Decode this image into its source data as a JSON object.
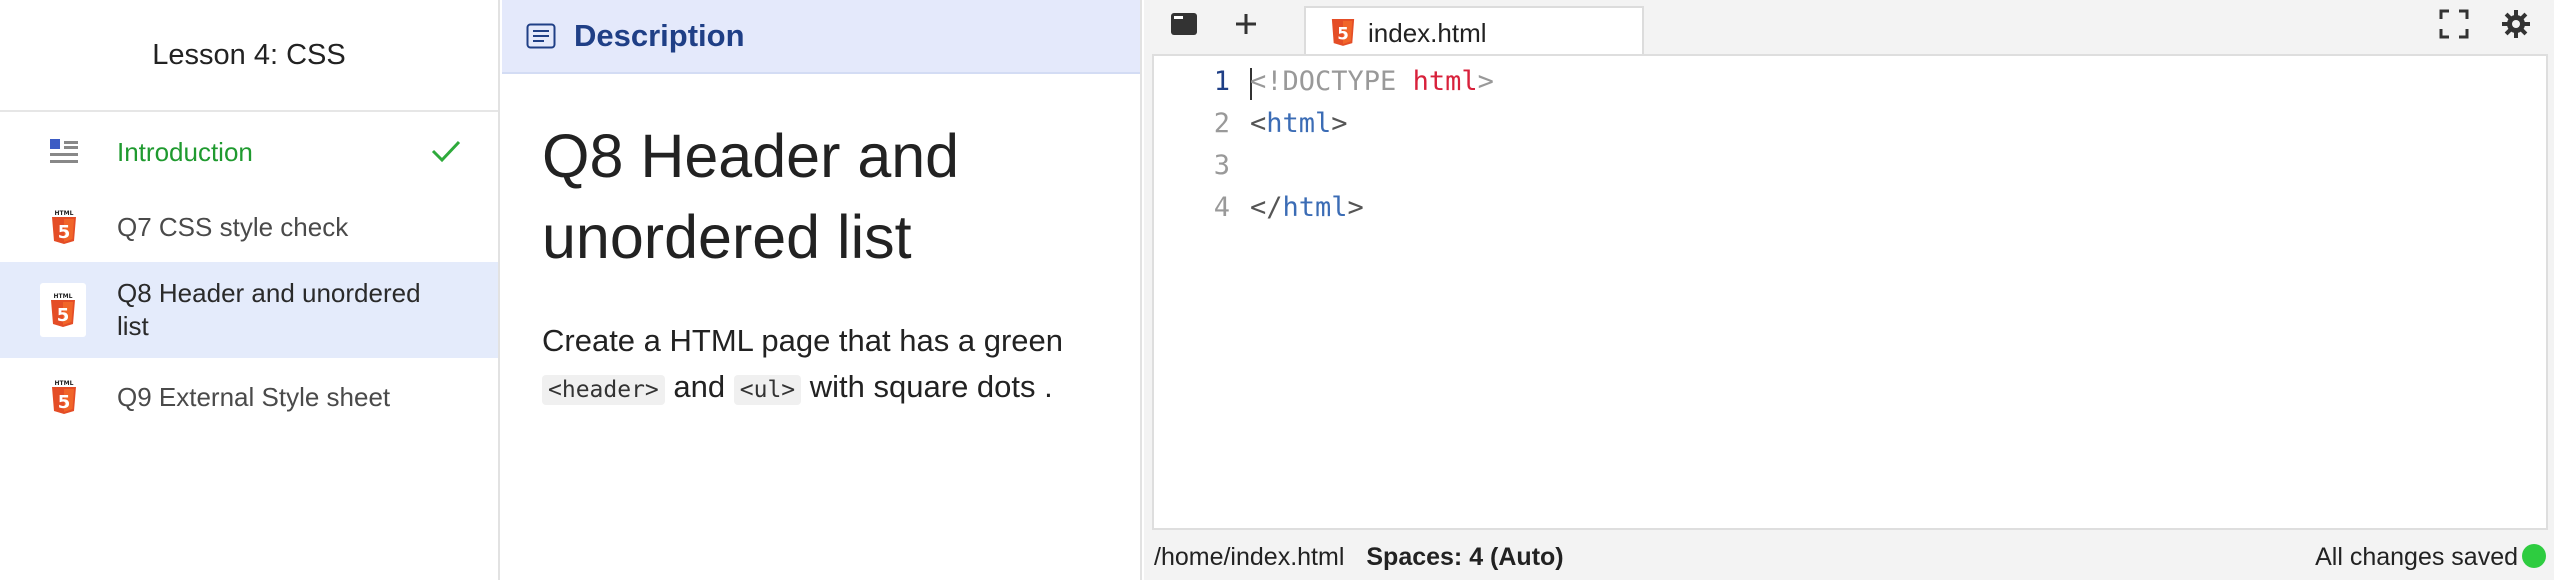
{
  "sidebar": {
    "lesson_title": "Lesson 4: CSS",
    "items": [
      {
        "label": "Introduction",
        "icon": "list-doc-icon",
        "completed": true
      },
      {
        "label": "Q7 CSS style check",
        "icon": "html5-icon"
      },
      {
        "label": "Q8 Header and unordered list",
        "icon": "html5-icon",
        "selected": true
      },
      {
        "label": "Q9 External Style sheet",
        "icon": "html5-icon"
      }
    ]
  },
  "description": {
    "header": "Description",
    "title": "Q8 Header and unordered list",
    "body_1": "Create a HTML page that has a green",
    "code_1": "<header>",
    "body_2": "and",
    "code_2": "<ul>",
    "body_3": "with square dots ."
  },
  "editor": {
    "tab_label": "index.html",
    "lines": [
      {
        "num": "1",
        "text": "<!DOCTYPE html>"
      },
      {
        "num": "2",
        "text": "<html>"
      },
      {
        "num": "3",
        "text": ""
      },
      {
        "num": "4",
        "text": "</html>"
      }
    ],
    "status": {
      "path": "/home/index.html",
      "spaces": "Spaces: 4 (Auto)",
      "saved": "All changes saved"
    }
  },
  "colors": {
    "accent_green": "#1f9a2f",
    "selected_bg": "#e4ebfb",
    "header_blue": "#1f3f86",
    "html5_orange": "#e44d26",
    "saved_dot": "#2ecc40"
  }
}
